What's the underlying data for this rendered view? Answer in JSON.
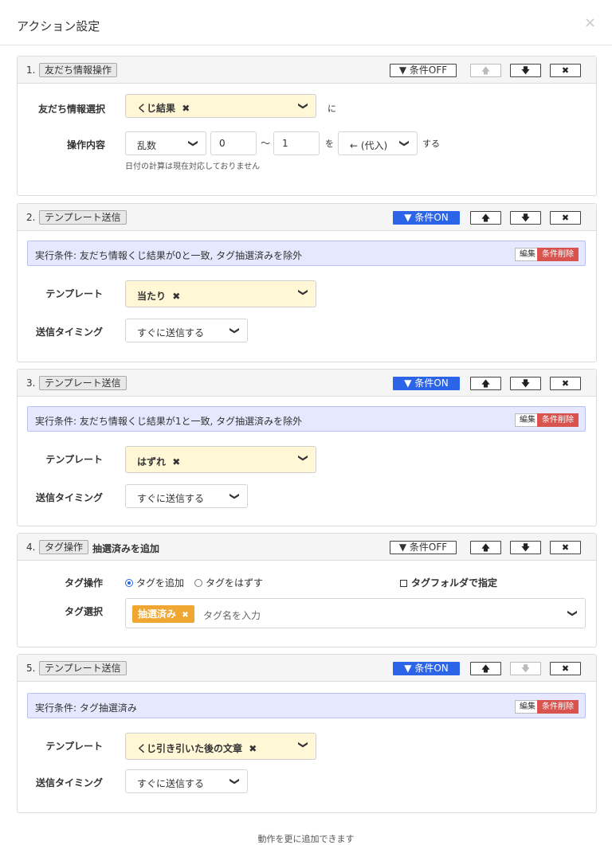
{
  "modal": {
    "title": "アクション設定",
    "close": "×"
  },
  "icons": {
    "filter": "▼",
    "up": "🡅",
    "down": "🡇",
    "delete": "✖",
    "caret": "❯",
    "remove": "✖"
  },
  "actions": [
    {
      "num": "1.",
      "type": "友だち情報操作",
      "condition_btn": "条件OFF",
      "condition_on": false,
      "up_disabled": true,
      "down_disabled": false,
      "friend_label": "友だち情報選択",
      "friend_value": "くじ結果",
      "ni": "に",
      "op_label": "操作内容",
      "op_select": "乱数",
      "range_from": "0",
      "tilde": "〜",
      "range_to": "1",
      "wo": "を",
      "assign_select": "← (代入)",
      "suru": "する",
      "note": "日付の計算は現在対応しておりません"
    },
    {
      "num": "2.",
      "type": "テンプレート送信",
      "condition_btn": "条件ON",
      "condition_on": true,
      "up_disabled": false,
      "down_disabled": false,
      "cond_text": "実行条件: 友だち情報くじ結果が0と一致, タグ抽選済みを除外",
      "edit": "編集",
      "cond_delete": "条件削除",
      "template_label": "テンプレート",
      "template_value": "当たり",
      "timing_label": "送信タイミング",
      "timing_value": "すぐに送信する"
    },
    {
      "num": "3.",
      "type": "テンプレート送信",
      "condition_btn": "条件ON",
      "condition_on": true,
      "up_disabled": false,
      "down_disabled": false,
      "cond_text": "実行条件: 友だち情報くじ結果が1と一致, タグ抽選済みを除外",
      "edit": "編集",
      "cond_delete": "条件削除",
      "template_label": "テンプレート",
      "template_value": "はずれ",
      "timing_label": "送信タイミング",
      "timing_value": "すぐに送信する"
    },
    {
      "num": "4.",
      "type": "タグ操作",
      "head_extra": "抽選済みを追加",
      "condition_btn": "条件OFF",
      "condition_on": false,
      "up_disabled": false,
      "down_disabled": false,
      "tagop_label": "タグ操作",
      "radio_add": "タグを追加",
      "radio_remove": "タグをはずす",
      "folder_check": "タグフォルダで指定",
      "tagsel_label": "タグ選択",
      "tag_chip": "抽選済み",
      "tag_placeholder": "タグ名を入力"
    },
    {
      "num": "5.",
      "type": "テンプレート送信",
      "condition_btn": "条件ON",
      "condition_on": true,
      "up_disabled": false,
      "down_disabled": true,
      "cond_text": "実行条件: タグ抽選済み",
      "edit": "編集",
      "cond_delete": "条件削除",
      "template_label": "テンプレート",
      "template_value": "くじ引き引いた後の文章",
      "timing_label": "送信タイミング",
      "timing_value": "すぐに送信する"
    }
  ],
  "footer": {
    "text": "動作を更に追加できます"
  }
}
